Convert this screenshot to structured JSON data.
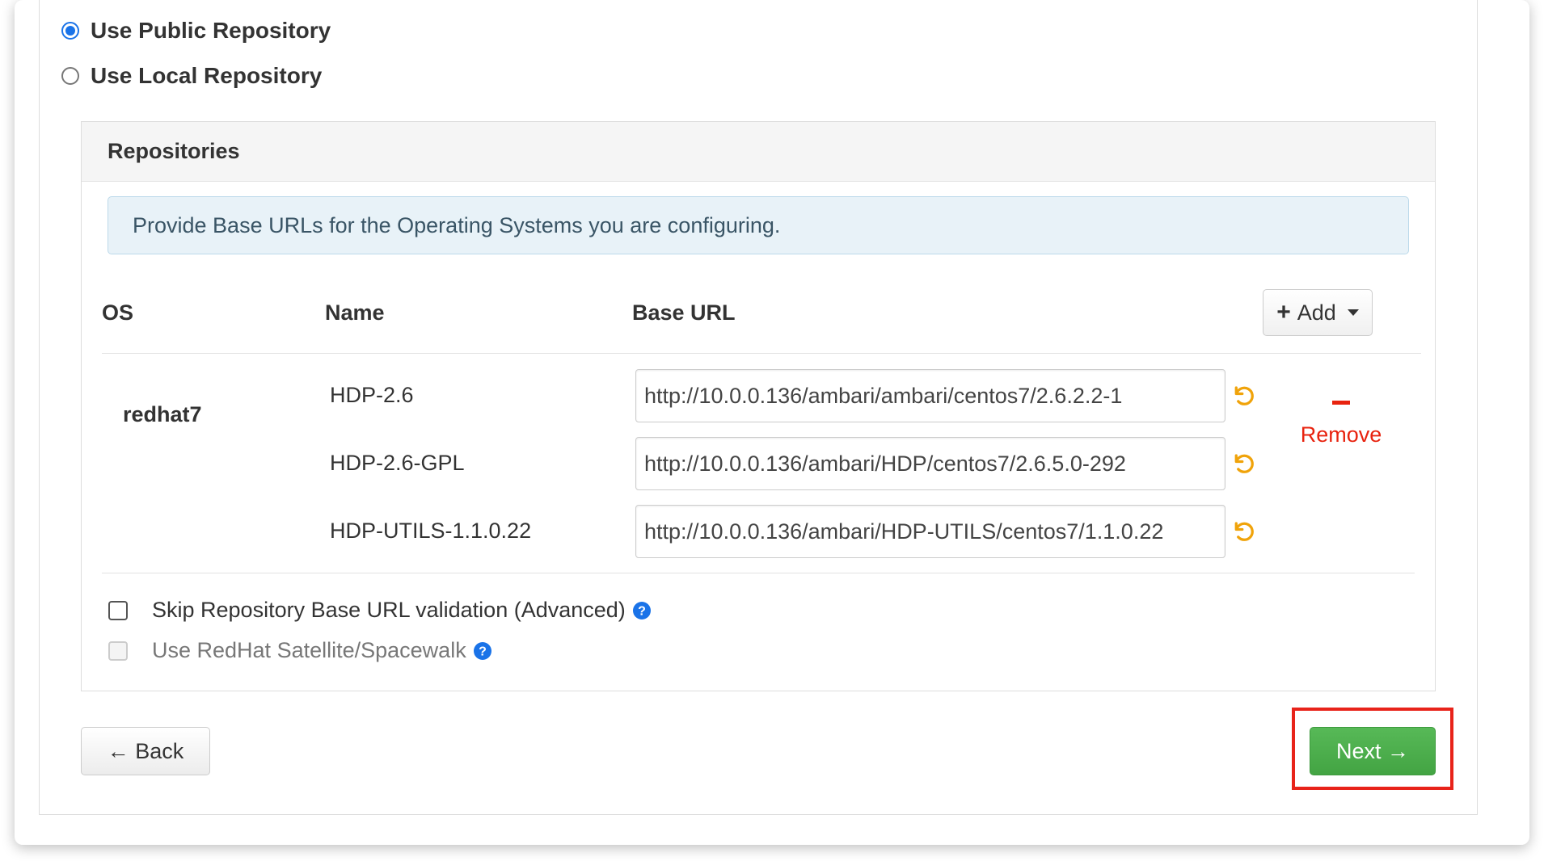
{
  "repository_source": {
    "public_label": "Use Public Repository",
    "public_selected": true,
    "local_label": "Use Local Repository",
    "local_selected": false
  },
  "repositories": {
    "title": "Repositories",
    "info_text": "Provide Base URLs for the Operating Systems you are configuring.",
    "columns": {
      "os": "OS",
      "name": "Name",
      "base_url": "Base URL"
    },
    "add_button": {
      "icon": "plus-icon",
      "label": "Add",
      "caret_icon": "caret-down-icon"
    },
    "os_groups": [
      {
        "os": "redhat7",
        "remove_label": "Remove",
        "repos": [
          {
            "name": "HDP-2.6",
            "base_url": "http://10.0.0.136/ambari/ambari/centos7/2.6.2.2-1"
          },
          {
            "name": "HDP-2.6-GPL",
            "base_url": "http://10.0.0.136/ambari/HDP/centos7/2.6.5.0-292"
          },
          {
            "name": "HDP-UTILS-1.1.0.22",
            "base_url": "http://10.0.0.136/ambari/HDP-UTILS/centos7/1.1.0.22"
          }
        ]
      }
    ],
    "options": {
      "skip_validation_label": "Skip Repository Base URL validation (Advanced)",
      "skip_validation_checked": false,
      "satellite_label": "Use RedHat Satellite/Spacewalk",
      "satellite_checked": false,
      "satellite_disabled": true
    }
  },
  "navigation": {
    "back_label": "← Back",
    "next_label": "Next →"
  },
  "colors": {
    "accent_blue": "#1a73e8",
    "remove_red": "#e8230f",
    "undo_orange": "#f0a30a",
    "next_green": "#4cae4c",
    "highlight_red": "#e8231a"
  }
}
